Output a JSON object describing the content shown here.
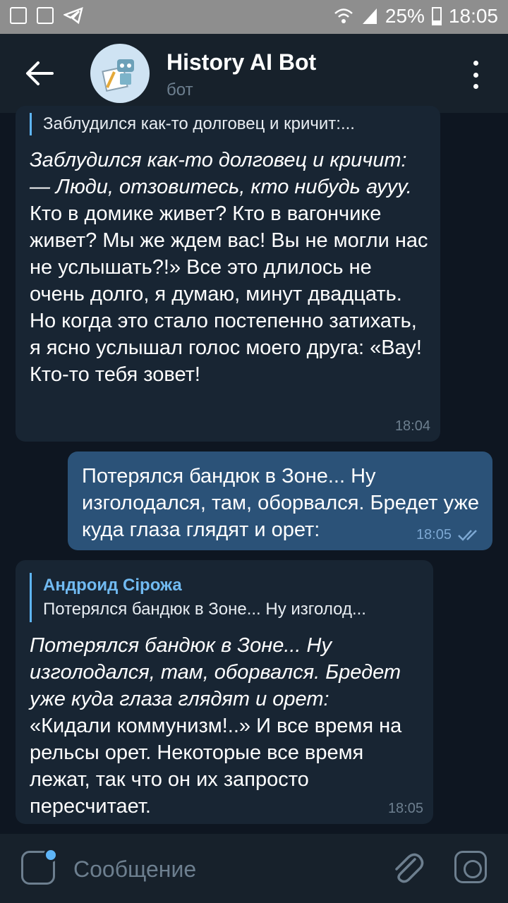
{
  "status_bar": {
    "battery": "25%",
    "time": "18:05"
  },
  "header": {
    "title": "History AI Bot",
    "subtitle": "бот",
    "avatar_icon": "robot-icon"
  },
  "messages": [
    {
      "reply_text": "Заблудился как-то долговец и кричит:...",
      "italic": "Заблудился как-то долговец и кричит:\n— Люди, отзовитесь, кто нибудь аууу.",
      "text": "Кто в домике живет? Кто в вагончике живет? Мы же ждем вас! Вы не могли нас не услышать?!» Все это длилось не очень долго, я думаю, минут двадцать. Но когда это стало постепенно затихать, я ясно услышал голос моего друга: «Вау! Кто-то тебя зовет!",
      "time": "18:04"
    },
    {
      "text": "Потерялся бандюк в Зоне... Ну изголодался, там, оборвался. Бредет уже куда глаза глядят и орет:",
      "time": "18:05"
    },
    {
      "reply_name": "Андроид Сірожа",
      "reply_text": "Потерялся бандюк в Зоне... Ну изголод...",
      "italic": "Потерялся бандюк в Зоне... Ну изголодался, там, оборвался. Бредет уже куда глаза глядят и орет:",
      "text": "«Кидали коммунизм!..» И все время на рельсы орет. Некоторые все время лежат, так что он их запросто пересчитает.",
      "time": "18:05"
    }
  ],
  "input": {
    "placeholder": "Сообщение"
  },
  "colors": {
    "background": "#0e1621",
    "header": "#17212b",
    "incoming": "#182533",
    "outgoing": "#2b5278",
    "accent": "#5eb5f7"
  }
}
